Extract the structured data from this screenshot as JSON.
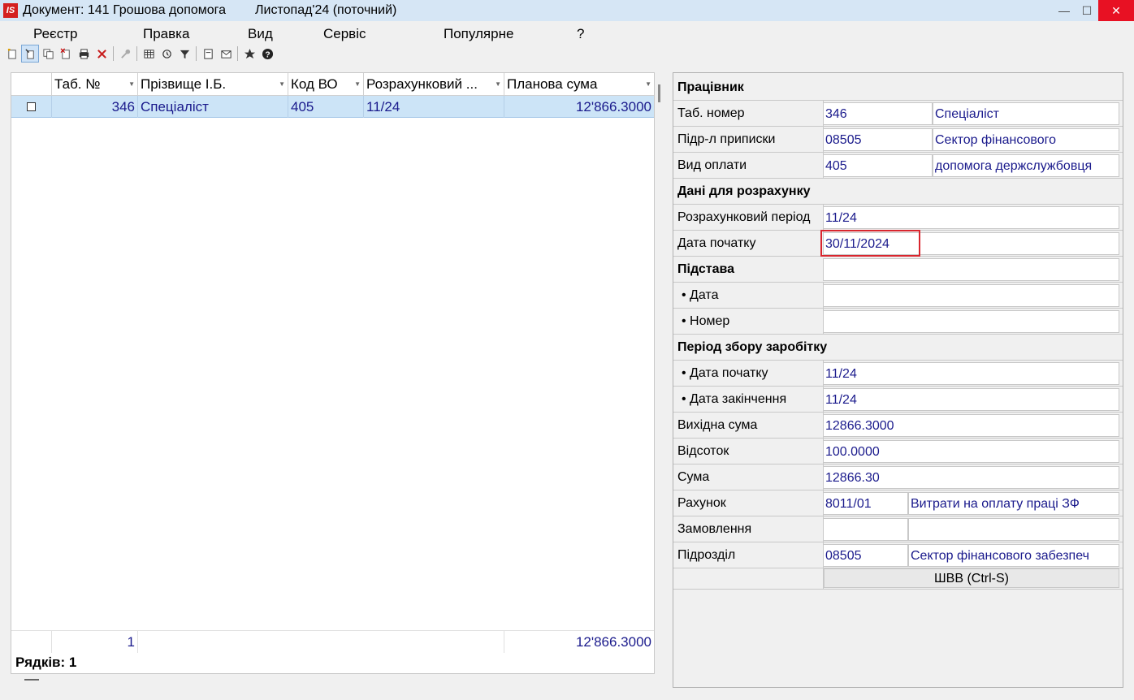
{
  "window": {
    "title": "Документ: 141 Грошова допомога",
    "period": "Листопад'24 (поточний)",
    "app_icon": "IS"
  },
  "menu": [
    "Реєстр",
    "Правка",
    "Вид",
    "Сервіс",
    "Популярне",
    "?"
  ],
  "grid": {
    "columns": [
      "Таб. №",
      "Прізвище І.Б.",
      "Код ВО",
      "Розрахунковий ...",
      "Планова сума"
    ],
    "rows": [
      {
        "tab": "346",
        "name": "Спеціаліст",
        "code": "405",
        "period": "11/24",
        "sum": "12'866.3000"
      }
    ],
    "footer": {
      "count": "1",
      "sum": "12'866.3000"
    },
    "rows_label": "Рядків: 1"
  },
  "details": {
    "worker_section": "Працівник",
    "tab_label": "Таб. номер",
    "tab_value": "346",
    "tab_name": "Спеціаліст",
    "dept_label": "Підр-л приписки",
    "dept_code": "08505",
    "dept_name": "Сектор фінансового",
    "paytype_label": "Вид оплати",
    "paytype_code": "405",
    "paytype_name": " допомога держслужбовця",
    "calc_section": "Дані для розрахунку",
    "calc_period_label": "Розрахунковий період",
    "calc_period_value": "11/24",
    "start_date_label": "Дата початку",
    "start_date_value": "30/11/2024",
    "basis_section": "Підстава",
    "basis_date_label": "• Дата",
    "basis_number_label": "• Номер",
    "earn_section": "Період збору заробітку",
    "earn_start_label": "• Дата початку",
    "earn_start_value": "11/24",
    "earn_end_label": "• Дата закінчення",
    "earn_end_value": "11/24",
    "source_sum_label": "Вихідна сума",
    "source_sum_value": "12866.3000",
    "percent_label": "Відсоток",
    "percent_value": "100.0000",
    "sum_label": "Сума",
    "sum_value": "12866.30",
    "account_label": "Рахунок",
    "account_code": "8011/01",
    "account_name": "Витрати на оплату праці ЗФ",
    "order_label": "Замовлення",
    "subdiv_label": "Підрозділ",
    "subdiv_code": "08505",
    "subdiv_name": "Сектор фінансового забезпеч",
    "shvv_button": "ШВВ (Ctrl-S)"
  },
  "colors": {
    "accent_highlight": "#d9262e",
    "selected_row": "#cce4f7",
    "value_text": "#1a1a8c"
  }
}
